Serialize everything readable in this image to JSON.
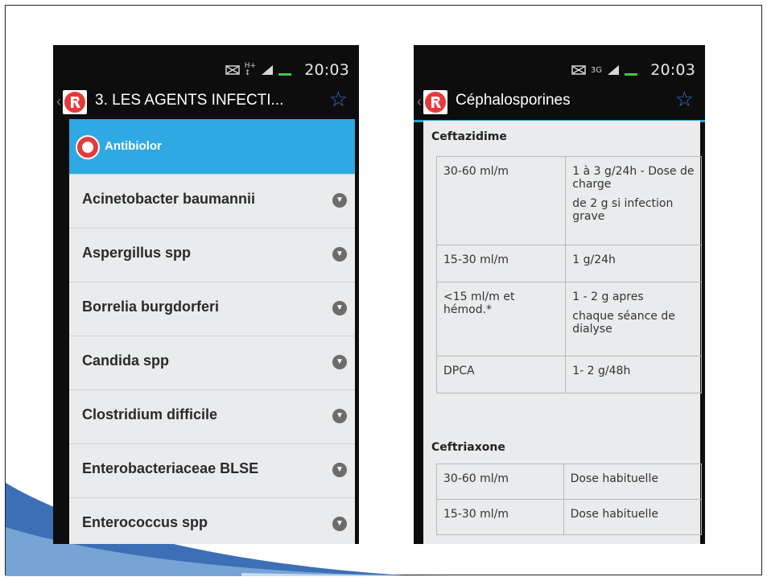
{
  "left_screen": {
    "status": {
      "time": "20:03"
    },
    "actionbar": {
      "title": "3. LES AGENTS INFECTI..."
    },
    "list_header": {
      "label": "Antibiolor"
    },
    "items": [
      {
        "label": "Acinetobacter baumannii"
      },
      {
        "label": "Aspergillus spp"
      },
      {
        "label": "Borrelia burgdorferi"
      },
      {
        "label": "Candida spp"
      },
      {
        "label": "Clostridium difficile"
      },
      {
        "label": "Enterobacteriaceae BLSE"
      },
      {
        "label": "Enterococcus spp"
      }
    ]
  },
  "right_screen": {
    "status": {
      "time": "20:03",
      "network": "3G"
    },
    "actionbar": {
      "title": "Céphalosporines"
    },
    "sections": [
      {
        "title": "Ceftazidime",
        "rows": [
          {
            "left": [
              "30-60 ml/m"
            ],
            "right": [
              "1 à 3 g/24h - Dose de charge",
              "de 2 g si infection grave"
            ]
          },
          {
            "left": [
              "15-30 ml/m"
            ],
            "right": [
              "1 g/24h"
            ]
          },
          {
            "left": [
              "<15 ml/m et hémod.*"
            ],
            "right": [
              "1 - 2 g apres",
              "chaque séance de dialyse"
            ]
          },
          {
            "left": [
              "DPCA"
            ],
            "right": [
              "1- 2 g/48h"
            ]
          }
        ]
      },
      {
        "title": "Ceftriaxone",
        "rows": [
          {
            "left": [
              "30-60 ml/m"
            ],
            "right": [
              "Dose habituelle"
            ]
          },
          {
            "left": [
              "15-30 ml/m"
            ],
            "right": [
              "Dose habituelle"
            ]
          }
        ]
      }
    ]
  },
  "colors": {
    "list_header": "#2ea9e3",
    "star": "#3d6fd6",
    "logo_red": "#e63a3a",
    "swoosh_blue": "#3b6fb6"
  }
}
